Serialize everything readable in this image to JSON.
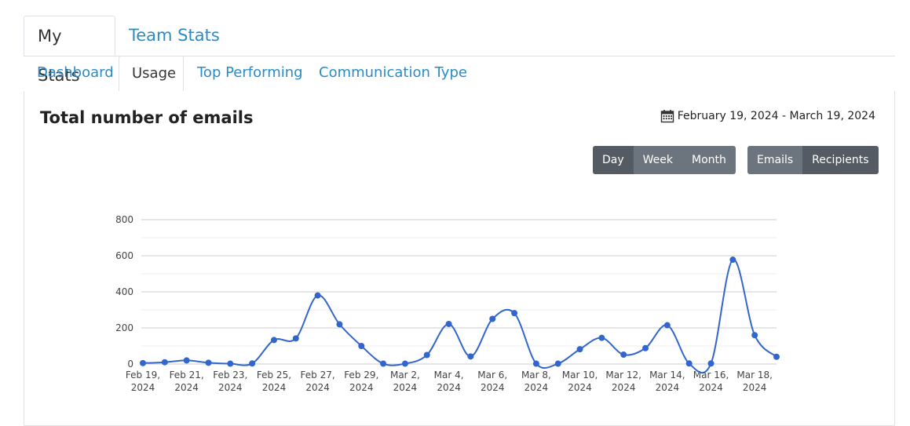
{
  "top_tabs": [
    {
      "label": "My Stats",
      "active": true
    },
    {
      "label": "Team Stats",
      "active": false
    }
  ],
  "sub_tabs": [
    {
      "label": "Dashboard",
      "active": false
    },
    {
      "label": "Usage",
      "active": true
    },
    {
      "label": "Top Performing",
      "active": false
    },
    {
      "label": "Communication Type",
      "active": false
    }
  ],
  "panel": {
    "title": "Total number of emails",
    "date_range": "February 19, 2024 - March 19, 2024"
  },
  "period_buttons": [
    {
      "label": "Day",
      "active": true
    },
    {
      "label": "Week",
      "active": false
    },
    {
      "label": "Month",
      "active": false
    }
  ],
  "metric_buttons": [
    {
      "label": "Emails",
      "active": false
    },
    {
      "label": "Recipients",
      "active": true
    }
  ],
  "colors": {
    "link": "#2a8bc7",
    "series": "#3366cc",
    "button": "#6c757d",
    "button_active": "#545b62"
  },
  "chart_data": {
    "type": "line",
    "title": "",
    "xlabel": "",
    "ylabel": "",
    "ylim": [
      0,
      800
    ],
    "yticks": [
      0,
      200,
      400,
      600,
      800
    ],
    "grid": true,
    "x": [
      "Feb 19, 2024",
      "Feb 20, 2024",
      "Feb 21, 2024",
      "Feb 22, 2024",
      "Feb 23, 2024",
      "Feb 24, 2024",
      "Feb 25, 2024",
      "Feb 26, 2024",
      "Feb 27, 2024",
      "Feb 28, 2024",
      "Feb 29, 2024",
      "Mar 1, 2024",
      "Mar 2, 2024",
      "Mar 3, 2024",
      "Mar 4, 2024",
      "Mar 5, 2024",
      "Mar 6, 2024",
      "Mar 7, 2024",
      "Mar 8, 2024",
      "Mar 9, 2024",
      "Mar 10, 2024",
      "Mar 11, 2024",
      "Mar 12, 2024",
      "Mar 13, 2024",
      "Mar 14, 2024",
      "Mar 15, 2024",
      "Mar 16, 2024",
      "Mar 17, 2024",
      "Mar 18, 2024",
      "Mar 19, 2024"
    ],
    "tick_labels": [
      {
        "index": 0,
        "line1": "Feb 19,",
        "line2": "2024"
      },
      {
        "index": 2,
        "line1": "Feb 21,",
        "line2": "2024"
      },
      {
        "index": 4,
        "line1": "Feb 23,",
        "line2": "2024"
      },
      {
        "index": 6,
        "line1": "Feb 25,",
        "line2": "2024"
      },
      {
        "index": 8,
        "line1": "Feb 27,",
        "line2": "2024"
      },
      {
        "index": 10,
        "line1": "Feb 29,",
        "line2": "2024"
      },
      {
        "index": 12,
        "line1": "Mar 2,",
        "line2": "2024"
      },
      {
        "index": 14,
        "line1": "Mar 4,",
        "line2": "2024"
      },
      {
        "index": 16,
        "line1": "Mar 6,",
        "line2": "2024"
      },
      {
        "index": 18,
        "line1": "Mar 8,",
        "line2": "2024"
      },
      {
        "index": 20,
        "line1": "Mar 10,",
        "line2": "2024"
      },
      {
        "index": 22,
        "line1": "Mar 12,",
        "line2": "2024"
      },
      {
        "index": 24,
        "line1": "Mar 14,",
        "line2": "2024"
      },
      {
        "index": 26,
        "line1": "Mar 16,",
        "line2": "2024"
      },
      {
        "index": 28,
        "line1": "Mar 18,",
        "line2": "2024"
      }
    ],
    "series": [
      {
        "values": [
          5,
          10,
          20,
          7,
          2,
          3,
          133,
          142,
          380,
          220,
          100,
          2,
          2,
          50,
          222,
          42,
          250,
          282,
          2,
          2,
          82,
          145,
          52,
          88,
          215,
          3,
          3,
          578,
          160,
          40
        ]
      }
    ]
  }
}
